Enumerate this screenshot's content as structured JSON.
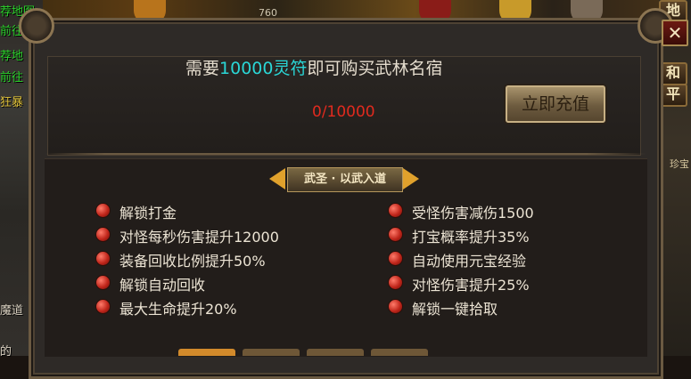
{
  "background": {
    "left_links": [
      "荐地图",
      "前往",
      "荐地",
      "前往",
      "狂暴",
      "魔道",
      "的"
    ],
    "left_counter": "760",
    "right_buttons": [
      "地",
      "和",
      "平"
    ],
    "right_label": "珍宝"
  },
  "dialog": {
    "close_label": "✕",
    "header": {
      "prefix": "需要",
      "amount": "10000灵符",
      "suffix": "即可购买武林名宿"
    },
    "progress": "0/10000",
    "charge_button": "立即充值",
    "banner_title": "武圣 · 以武入道",
    "perks_left": [
      "解锁打金",
      "对怪每秒伤害提升12000",
      "装备回收比例提升50%",
      "解锁自动回收",
      "最大生命提升20%"
    ],
    "perks_right": [
      "受怪伤害减伤1500",
      "打宝概率提升35%",
      "自动使用元宝经验",
      "对怪伤害提升25%",
      "解锁一键拾取"
    ]
  },
  "colors": {
    "highlight": "#2ad6d6",
    "progress": "#e12a1e",
    "bullet": "#c0261b",
    "banner_arrow": "#e0a12c"
  }
}
